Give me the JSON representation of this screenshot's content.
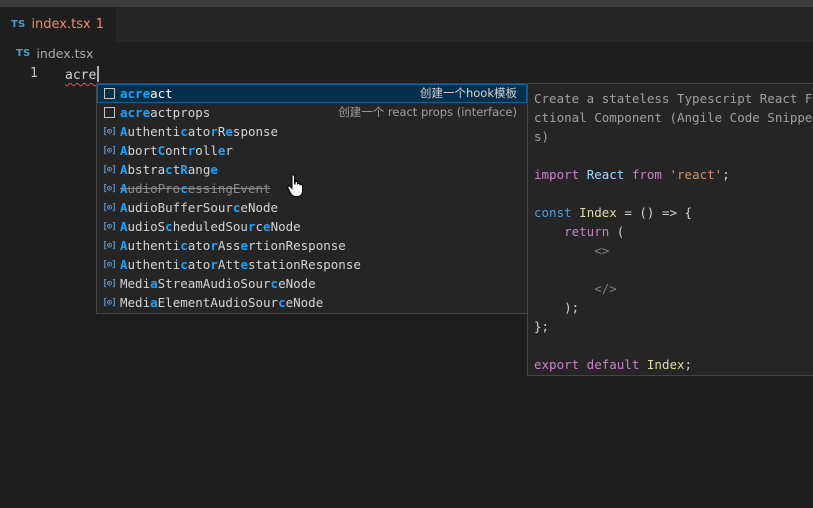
{
  "tab": {
    "badge": "TS",
    "name": "index.tsx",
    "problems": "1"
  },
  "breadcrumb": {
    "badge": "TS",
    "file": "index.tsx"
  },
  "editor": {
    "line_number": "1",
    "typed_text": "acre"
  },
  "suggestions": [
    {
      "icon": "snippet-icon",
      "pre": "",
      "match": "acre",
      "post": "act",
      "detail": "创建一个hook模板",
      "selected": true
    },
    {
      "icon": "snippet-icon",
      "pre": "",
      "match": "acre",
      "post": "actprops",
      "detail": "创建一个 react props (interface)"
    },
    {
      "icon": "variable-icon",
      "label": "AuthenticatorResponse"
    },
    {
      "icon": "variable-icon",
      "label": "AbortController"
    },
    {
      "icon": "variable-icon",
      "label": "AbstractRange"
    },
    {
      "icon": "variable-icon",
      "label": "AudioProcessingEvent",
      "deprecated": true
    },
    {
      "icon": "variable-icon",
      "label": "AudioBufferSourceNode"
    },
    {
      "icon": "variable-icon",
      "label": "AudioScheduledSourceNode"
    },
    {
      "icon": "variable-icon",
      "label": "AuthenticatorAssertionResponse"
    },
    {
      "icon": "variable-icon",
      "label": "AuthenticatorAttestationResponse"
    },
    {
      "icon": "variable-icon",
      "label": "MediaStreamAudioSourceNode"
    },
    {
      "icon": "variable-icon",
      "label": "MediaElementAudioSourceNode"
    }
  ],
  "details": {
    "description_lines": [
      "Create a stateless Typescript React F",
      "ctional Component (Angile Code Snippe",
      "s)"
    ],
    "code": {
      "import": "import",
      "react_name": "React",
      "from": "from",
      "module": "'react'",
      "semicolon": ";",
      "const": "const",
      "component": "Index",
      "arrow": "= () => {",
      "return": "return",
      "open_paren": "(",
      "frag_open": "<>",
      "frag_close": "</>",
      "close_paren": ");",
      "close_brace": "};",
      "export": "export default",
      "export_name": "Index",
      "export_semi": ";"
    }
  }
}
